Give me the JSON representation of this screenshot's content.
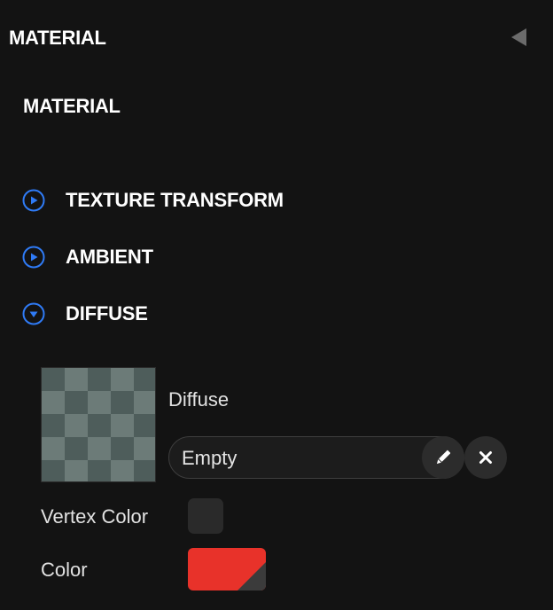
{
  "panel": {
    "title": "MATERIAL",
    "collapse_icon": "triangle-left-icon"
  },
  "section": {
    "title": "MATERIAL"
  },
  "groups": [
    {
      "label": "TEXTURE TRANSFORM",
      "expanded": false,
      "icon": "circle-play-icon"
    },
    {
      "label": "AMBIENT",
      "expanded": false,
      "icon": "circle-play-icon"
    },
    {
      "label": "DIFFUSE",
      "expanded": true,
      "icon": "circle-chevron-down-icon"
    }
  ],
  "diffuse": {
    "label": "Diffuse",
    "texture_value": "Empty",
    "edit_icon": "pencil-icon",
    "clear_icon": "close-icon",
    "vertex_color_label": "Vertex Color",
    "vertex_color_enabled": false,
    "color_label": "Color",
    "color_value": "#e8322a"
  },
  "colors": {
    "background": "#131313",
    "accent": "#2f7bf6",
    "swatch_red": "#e8322a"
  }
}
